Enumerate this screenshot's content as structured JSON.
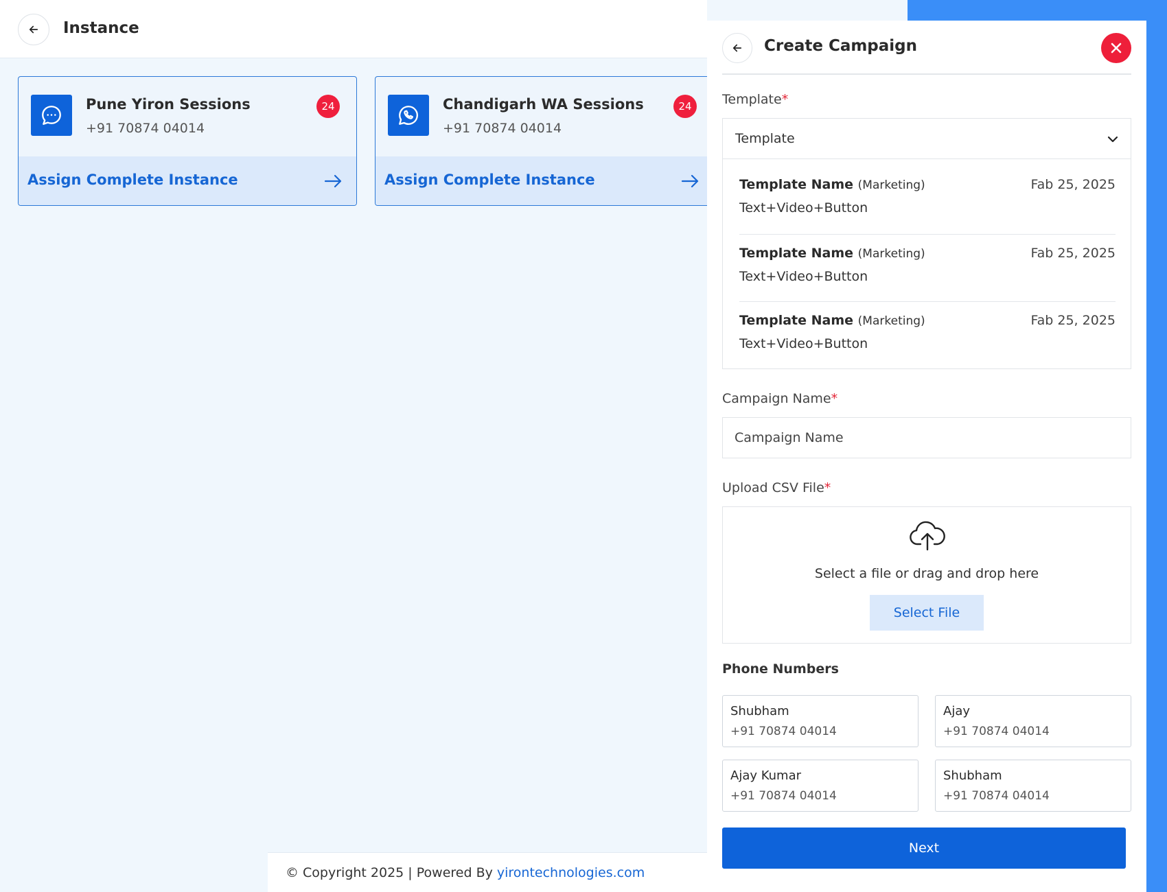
{
  "header": {
    "title": "Instance"
  },
  "instances": [
    {
      "name": "Pune Yiron Sessions",
      "phone": "+91 70874 04014",
      "badge": "24",
      "action": "Assign Complete Instance",
      "icon": "chat-bubble-icon"
    },
    {
      "name": "Chandigarh WA Sessions",
      "phone": "+91 70874 04014",
      "badge": "24",
      "action": "Assign Complete Instance",
      "icon": "whatsapp-icon"
    }
  ],
  "footer": {
    "copyright": "© Copyright 2025 | Powered By ",
    "link": "yirontechnologies.com"
  },
  "panel": {
    "title": "Create Campaign",
    "template": {
      "label": "Template",
      "required_mark": "*",
      "selected": "Template",
      "options": [
        {
          "name": "Template Name",
          "category": "(Marketing)",
          "date": "Fab 25, 2025",
          "type": "Text+Video+Button"
        },
        {
          "name": "Template Name",
          "category": "(Marketing)",
          "date": "Fab 25, 2025",
          "type": "Text+Video+Button"
        },
        {
          "name": "Template Name",
          "category": "(Marketing)",
          "date": "Fab 25, 2025",
          "type": "Text+Video+Button"
        }
      ]
    },
    "campaign_name": {
      "label": "Campaign Name",
      "required_mark": "*",
      "placeholder": "Campaign Name",
      "value": ""
    },
    "upload": {
      "label": "Upload CSV File",
      "required_mark": "*",
      "text": "Select a file or drag and drop here",
      "button": "Select File"
    },
    "phone_numbers": {
      "label": "Phone Numbers",
      "items": [
        {
          "name": "Shubham",
          "phone": "+91 70874 04014"
        },
        {
          "name": "Ajay",
          "phone": "+91 70874 04014"
        },
        {
          "name": "Ajay Kumar",
          "phone": "+91 70874 04014"
        },
        {
          "name": "Shubham",
          "phone": "+91 70874 04014"
        }
      ]
    },
    "next_button": "Next"
  },
  "colors": {
    "primary": "#0e63da",
    "link": "#1666d4",
    "danger": "#ee1f3a",
    "frame": "#3a8ef8",
    "background": "#f0f7fd"
  }
}
